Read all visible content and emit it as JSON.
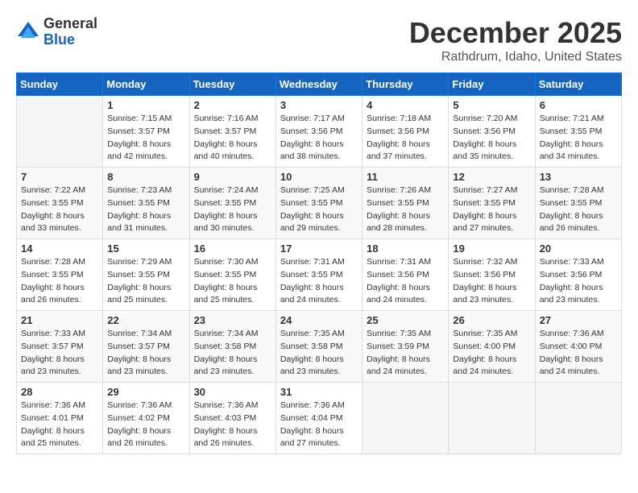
{
  "header": {
    "logo_general": "General",
    "logo_blue": "Blue",
    "month": "December 2025",
    "location": "Rathdrum, Idaho, United States"
  },
  "days_of_week": [
    "Sunday",
    "Monday",
    "Tuesday",
    "Wednesday",
    "Thursday",
    "Friday",
    "Saturday"
  ],
  "weeks": [
    [
      {
        "day": "",
        "info": ""
      },
      {
        "day": "1",
        "info": "Sunrise: 7:15 AM\nSunset: 3:57 PM\nDaylight: 8 hours\nand 42 minutes."
      },
      {
        "day": "2",
        "info": "Sunrise: 7:16 AM\nSunset: 3:57 PM\nDaylight: 8 hours\nand 40 minutes."
      },
      {
        "day": "3",
        "info": "Sunrise: 7:17 AM\nSunset: 3:56 PM\nDaylight: 8 hours\nand 38 minutes."
      },
      {
        "day": "4",
        "info": "Sunrise: 7:18 AM\nSunset: 3:56 PM\nDaylight: 8 hours\nand 37 minutes."
      },
      {
        "day": "5",
        "info": "Sunrise: 7:20 AM\nSunset: 3:56 PM\nDaylight: 8 hours\nand 35 minutes."
      },
      {
        "day": "6",
        "info": "Sunrise: 7:21 AM\nSunset: 3:55 PM\nDaylight: 8 hours\nand 34 minutes."
      }
    ],
    [
      {
        "day": "7",
        "info": "Sunrise: 7:22 AM\nSunset: 3:55 PM\nDaylight: 8 hours\nand 33 minutes."
      },
      {
        "day": "8",
        "info": "Sunrise: 7:23 AM\nSunset: 3:55 PM\nDaylight: 8 hours\nand 31 minutes."
      },
      {
        "day": "9",
        "info": "Sunrise: 7:24 AM\nSunset: 3:55 PM\nDaylight: 8 hours\nand 30 minutes."
      },
      {
        "day": "10",
        "info": "Sunrise: 7:25 AM\nSunset: 3:55 PM\nDaylight: 8 hours\nand 29 minutes."
      },
      {
        "day": "11",
        "info": "Sunrise: 7:26 AM\nSunset: 3:55 PM\nDaylight: 8 hours\nand 28 minutes."
      },
      {
        "day": "12",
        "info": "Sunrise: 7:27 AM\nSunset: 3:55 PM\nDaylight: 8 hours\nand 27 minutes."
      },
      {
        "day": "13",
        "info": "Sunrise: 7:28 AM\nSunset: 3:55 PM\nDaylight: 8 hours\nand 26 minutes."
      }
    ],
    [
      {
        "day": "14",
        "info": "Sunrise: 7:28 AM\nSunset: 3:55 PM\nDaylight: 8 hours\nand 26 minutes."
      },
      {
        "day": "15",
        "info": "Sunrise: 7:29 AM\nSunset: 3:55 PM\nDaylight: 8 hours\nand 25 minutes."
      },
      {
        "day": "16",
        "info": "Sunrise: 7:30 AM\nSunset: 3:55 PM\nDaylight: 8 hours\nand 25 minutes."
      },
      {
        "day": "17",
        "info": "Sunrise: 7:31 AM\nSunset: 3:55 PM\nDaylight: 8 hours\nand 24 minutes."
      },
      {
        "day": "18",
        "info": "Sunrise: 7:31 AM\nSunset: 3:56 PM\nDaylight: 8 hours\nand 24 minutes."
      },
      {
        "day": "19",
        "info": "Sunrise: 7:32 AM\nSunset: 3:56 PM\nDaylight: 8 hours\nand 23 minutes."
      },
      {
        "day": "20",
        "info": "Sunrise: 7:33 AM\nSunset: 3:56 PM\nDaylight: 8 hours\nand 23 minutes."
      }
    ],
    [
      {
        "day": "21",
        "info": "Sunrise: 7:33 AM\nSunset: 3:57 PM\nDaylight: 8 hours\nand 23 minutes."
      },
      {
        "day": "22",
        "info": "Sunrise: 7:34 AM\nSunset: 3:57 PM\nDaylight: 8 hours\nand 23 minutes."
      },
      {
        "day": "23",
        "info": "Sunrise: 7:34 AM\nSunset: 3:58 PM\nDaylight: 8 hours\nand 23 minutes."
      },
      {
        "day": "24",
        "info": "Sunrise: 7:35 AM\nSunset: 3:58 PM\nDaylight: 8 hours\nand 23 minutes."
      },
      {
        "day": "25",
        "info": "Sunrise: 7:35 AM\nSunset: 3:59 PM\nDaylight: 8 hours\nand 24 minutes."
      },
      {
        "day": "26",
        "info": "Sunrise: 7:35 AM\nSunset: 4:00 PM\nDaylight: 8 hours\nand 24 minutes."
      },
      {
        "day": "27",
        "info": "Sunrise: 7:36 AM\nSunset: 4:00 PM\nDaylight: 8 hours\nand 24 minutes."
      }
    ],
    [
      {
        "day": "28",
        "info": "Sunrise: 7:36 AM\nSunset: 4:01 PM\nDaylight: 8 hours\nand 25 minutes."
      },
      {
        "day": "29",
        "info": "Sunrise: 7:36 AM\nSunset: 4:02 PM\nDaylight: 8 hours\nand 26 minutes."
      },
      {
        "day": "30",
        "info": "Sunrise: 7:36 AM\nSunset: 4:03 PM\nDaylight: 8 hours\nand 26 minutes."
      },
      {
        "day": "31",
        "info": "Sunrise: 7:36 AM\nSunset: 4:04 PM\nDaylight: 8 hours\nand 27 minutes."
      },
      {
        "day": "",
        "info": ""
      },
      {
        "day": "",
        "info": ""
      },
      {
        "day": "",
        "info": ""
      }
    ]
  ]
}
